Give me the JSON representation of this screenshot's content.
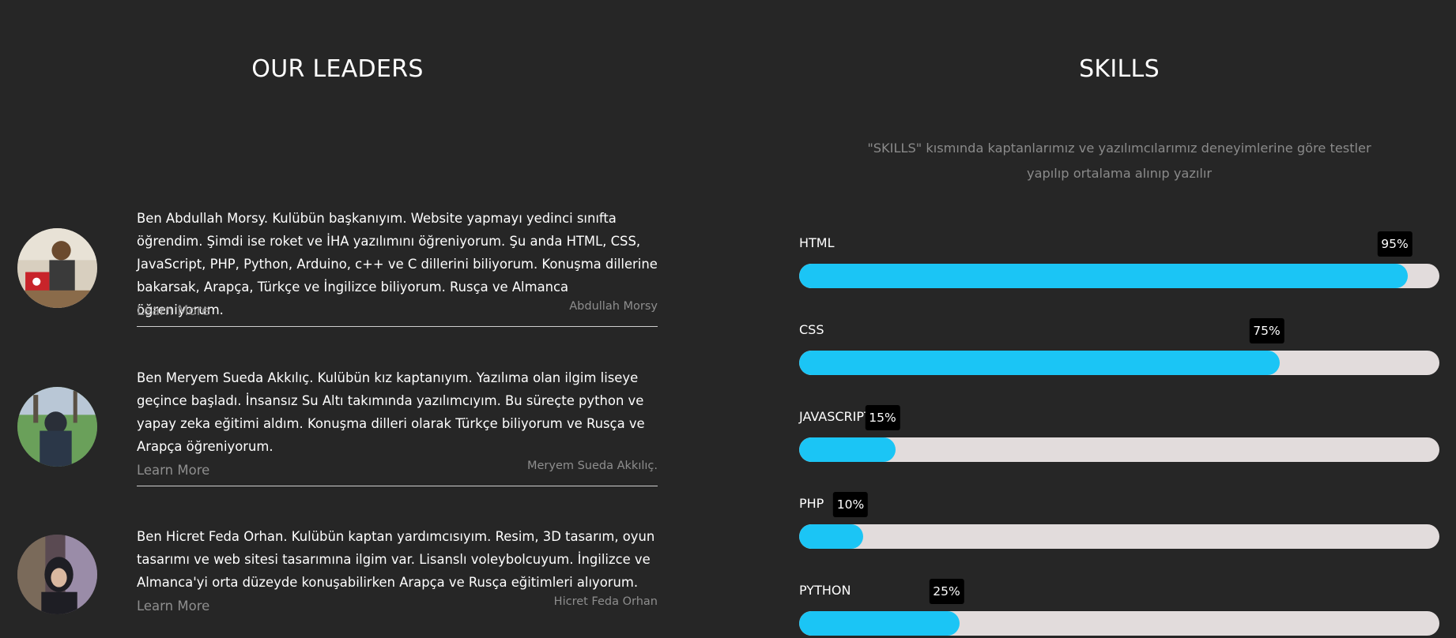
{
  "leaders_section": {
    "title": "OUR LEADERS",
    "learn_more_label": "Learn More",
    "leaders": [
      {
        "bio": "Ben Abdullah Morsy. Kulübün başkanıyım. Website yapmayı yedinci sınıfta öğrendim. Şimdi ise roket ve İHA yazılımını öğreniyorum. Şu anda HTML, CSS, JavaScript, PHP, Python, Arduino, c++ ve C dillerini biliyorum. Konuşma dillerine bakarsak, Arapça, Türkçe ve İngilizce biliyorum. Rusça ve Almanca öğreniyorum.",
        "name": "Abdullah Morsy"
      },
      {
        "bio": "Ben Meryem Sueda Akkılıç. Kulübün kız kaptanıyım. Yazılıma olan ilgim liseye geçince başladı. İnsansız Su Altı takımında yazılımcıyım. Bu süreçte python ve yapay zeka eğitimi aldım. Konuşma dilleri olarak Türkçe biliyorum ve Rusça ve Arapça öğreniyorum.",
        "name": "Meryem Sueda Akkılıç."
      },
      {
        "bio": "Ben Hicret Feda Orhan. Kulübün kaptan yardımcısıyım. Resim, 3D tasarım, oyun tasarımı ve web sitesi tasarımına ilgim var. Lisanslı voleybolcuyum. İngilizce ve Almanca'yi orta düzeyde konuşabilirken Arapça ve Rusça eğitimleri alıyorum.",
        "name": "Hicret Feda Orhan"
      }
    ]
  },
  "skills_section": {
    "title": "SKILLS",
    "description": "\"SKILLS\" kısmında kaptanlarımız ve yazılımcılarımız deneyimlerine göre testler yapılıp ortalama alınıp yazılır",
    "skills": [
      {
        "label": "HTML",
        "percent_label": "95%",
        "value": 95
      },
      {
        "label": "CSS",
        "percent_label": "75%",
        "value": 75
      },
      {
        "label": "JAVASCRIPT",
        "percent_label": "15%",
        "value": 15
      },
      {
        "label": "PHP",
        "percent_label": "10%",
        "value": 10
      },
      {
        "label": "PYTHON",
        "percent_label": "25%",
        "value": 25
      }
    ]
  },
  "colors": {
    "background": "#262626",
    "accent": "#1bc5f5",
    "track": "#e2dcdc",
    "badge": "#000000"
  }
}
